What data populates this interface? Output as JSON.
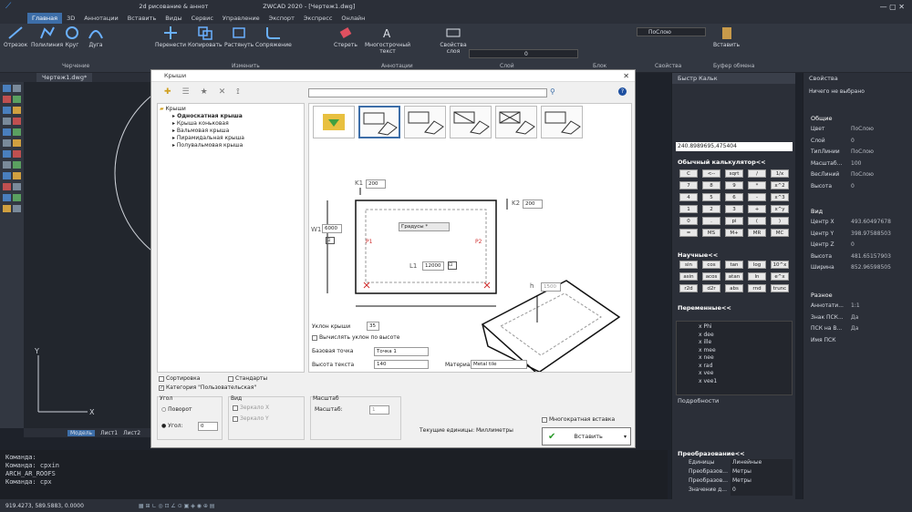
{
  "app": {
    "title": "ZWCAD 2020 - [Чертеж1.dwg]",
    "workspace": "2d рисование & аннот"
  },
  "menu_tabs": [
    "Главная",
    "3D",
    "Аннотации",
    "Вставить",
    "Виды",
    "Сервис",
    "Управление",
    "Экспорт",
    "Экспресс",
    "Онлайн"
  ],
  "ribbon": {
    "draw": [
      "Отрезок",
      "Полилиния",
      "Круг",
      "Дуга"
    ],
    "modify": [
      "Перенести",
      "Копировать",
      "Растянуть",
      "Сопряжение",
      "Стереть"
    ],
    "annot": [
      "Многострочный текст"
    ],
    "layers": [
      "Свойства слоя"
    ],
    "layer_value": "0",
    "prop_layer": "ПоСлою",
    "paste": "Вставить",
    "groups": [
      "Черчение",
      "Изменить",
      "Аннотации",
      "Слой",
      "Блок",
      "Свойства",
      "Буфер обмена"
    ]
  },
  "doc_tab": "Чертеж1.dwg*",
  "layout_tabs": [
    "Модель",
    "Лист1",
    "Лист2"
  ],
  "command": {
    "lines": [
      "Команда:",
      "Команда: cpxin",
      "ARCH_AR_ROOFS",
      "Команда: cpx"
    ]
  },
  "coords": "919.4273, 589.5883, 0.0000",
  "dialog": {
    "title": "Крыши",
    "tree_root": "Крыши",
    "tree": [
      "Односкатная крыша",
      "Крыша коньковая",
      "Вальмовая крыша",
      "Пирамидальная крыша",
      "Полувальмовая крыша"
    ],
    "labels": {
      "k1": "K1",
      "k2": "K2",
      "w1": "W1",
      "l1": "L1",
      "p1": "P1",
      "p2": "P2",
      "h": "h"
    },
    "k1": "200",
    "k2": "200",
    "w1": "6000",
    "l1": "12000",
    "h": "1500",
    "degrees": "Градусы *",
    "slope_label": "Уклон крыши",
    "slope": "35",
    "calc_slope": "Вычислять уклон по высоте",
    "base_point_label": "Базовая точка",
    "base_point": "Точка 1",
    "text_height_label": "Высота текста",
    "text_height": "140",
    "material_label": "Материал",
    "material": "Metal tile",
    "sort": "Сортировка",
    "standard": "Стандарты",
    "category": "Категория \"Пользовательская\"",
    "angle_group": "Угол",
    "rotate": "Поворот",
    "angle_label": "Угол:",
    "angle": "0",
    "view_group": "Вид",
    "mirror_x": "Зеркало X",
    "mirror_y": "Зеркало Y",
    "scale_group": "Масштаб",
    "scale_label": "Масштаб:",
    "scale": "1",
    "units": "Текущие единицы: Миллиметры",
    "multi": "Многократная вставка",
    "insert": "Вставить"
  },
  "calc": {
    "title": "Быстр Кальк",
    "value": "240.8989695,475404",
    "basic_title": "Обычный калькулятор<<",
    "basic": [
      "C",
      "<--",
      "sqrt",
      "/",
      "1/x",
      "7",
      "8",
      "9",
      "*",
      "x^2",
      "4",
      "5",
      "6",
      "-",
      "x^3",
      "1",
      "2",
      "3",
      "+",
      "x^y",
      "0",
      ".",
      "pi",
      "(",
      ")",
      "=",
      "MS",
      "M+",
      "MR",
      "MC"
    ],
    "sci_title": "Научные<<",
    "sci": [
      "sin",
      "cos",
      "tan",
      "log",
      "10^x",
      "asin",
      "acos",
      "atan",
      "ln",
      "e^x",
      "r2d",
      "d2r",
      "abs",
      "rnd",
      "trunc"
    ],
    "vars_title": "Переменные<<",
    "vars": [
      "Phi",
      "dee",
      "ille",
      "mee",
      "nee",
      "rad",
      "vee",
      "vee1"
    ],
    "details": "Подробности",
    "conv_title": "Преобразование<<",
    "conv_rows": [
      [
        "Единицы",
        "Линейные"
      ],
      [
        "Преобразов...",
        "Метры"
      ],
      [
        "Преобразов...",
        "Метры"
      ],
      [
        "Значение д...",
        "0"
      ]
    ]
  },
  "props": {
    "title": "Свойства",
    "selection": "Ничего не выбрано",
    "general": "Общие",
    "rows": [
      [
        "Цвет",
        "ПоСлою"
      ],
      [
        "Слой",
        "0"
      ],
      [
        "ТипЛинии",
        "ПоСлою"
      ],
      [
        "Масштаб...",
        "100"
      ],
      [
        "ВесЛиний",
        "ПоСлою"
      ],
      [
        "Высота",
        "0"
      ]
    ],
    "view": "Вид",
    "view_rows": [
      [
        "Центр X",
        "493.60497678"
      ],
      [
        "Центр Y",
        "398.97588503"
      ],
      [
        "Центр Z",
        "0"
      ],
      [
        "Высота",
        "481.65157903"
      ],
      [
        "Ширина",
        "852.96598505"
      ]
    ],
    "misc": "Разное",
    "misc_rows": [
      [
        "Аннотати...",
        "1:1"
      ],
      [
        "Знак ПСК...",
        "Да"
      ],
      [
        "ПСК на В...",
        "Да"
      ],
      [
        "Имя ПСК",
        ""
      ]
    ]
  }
}
